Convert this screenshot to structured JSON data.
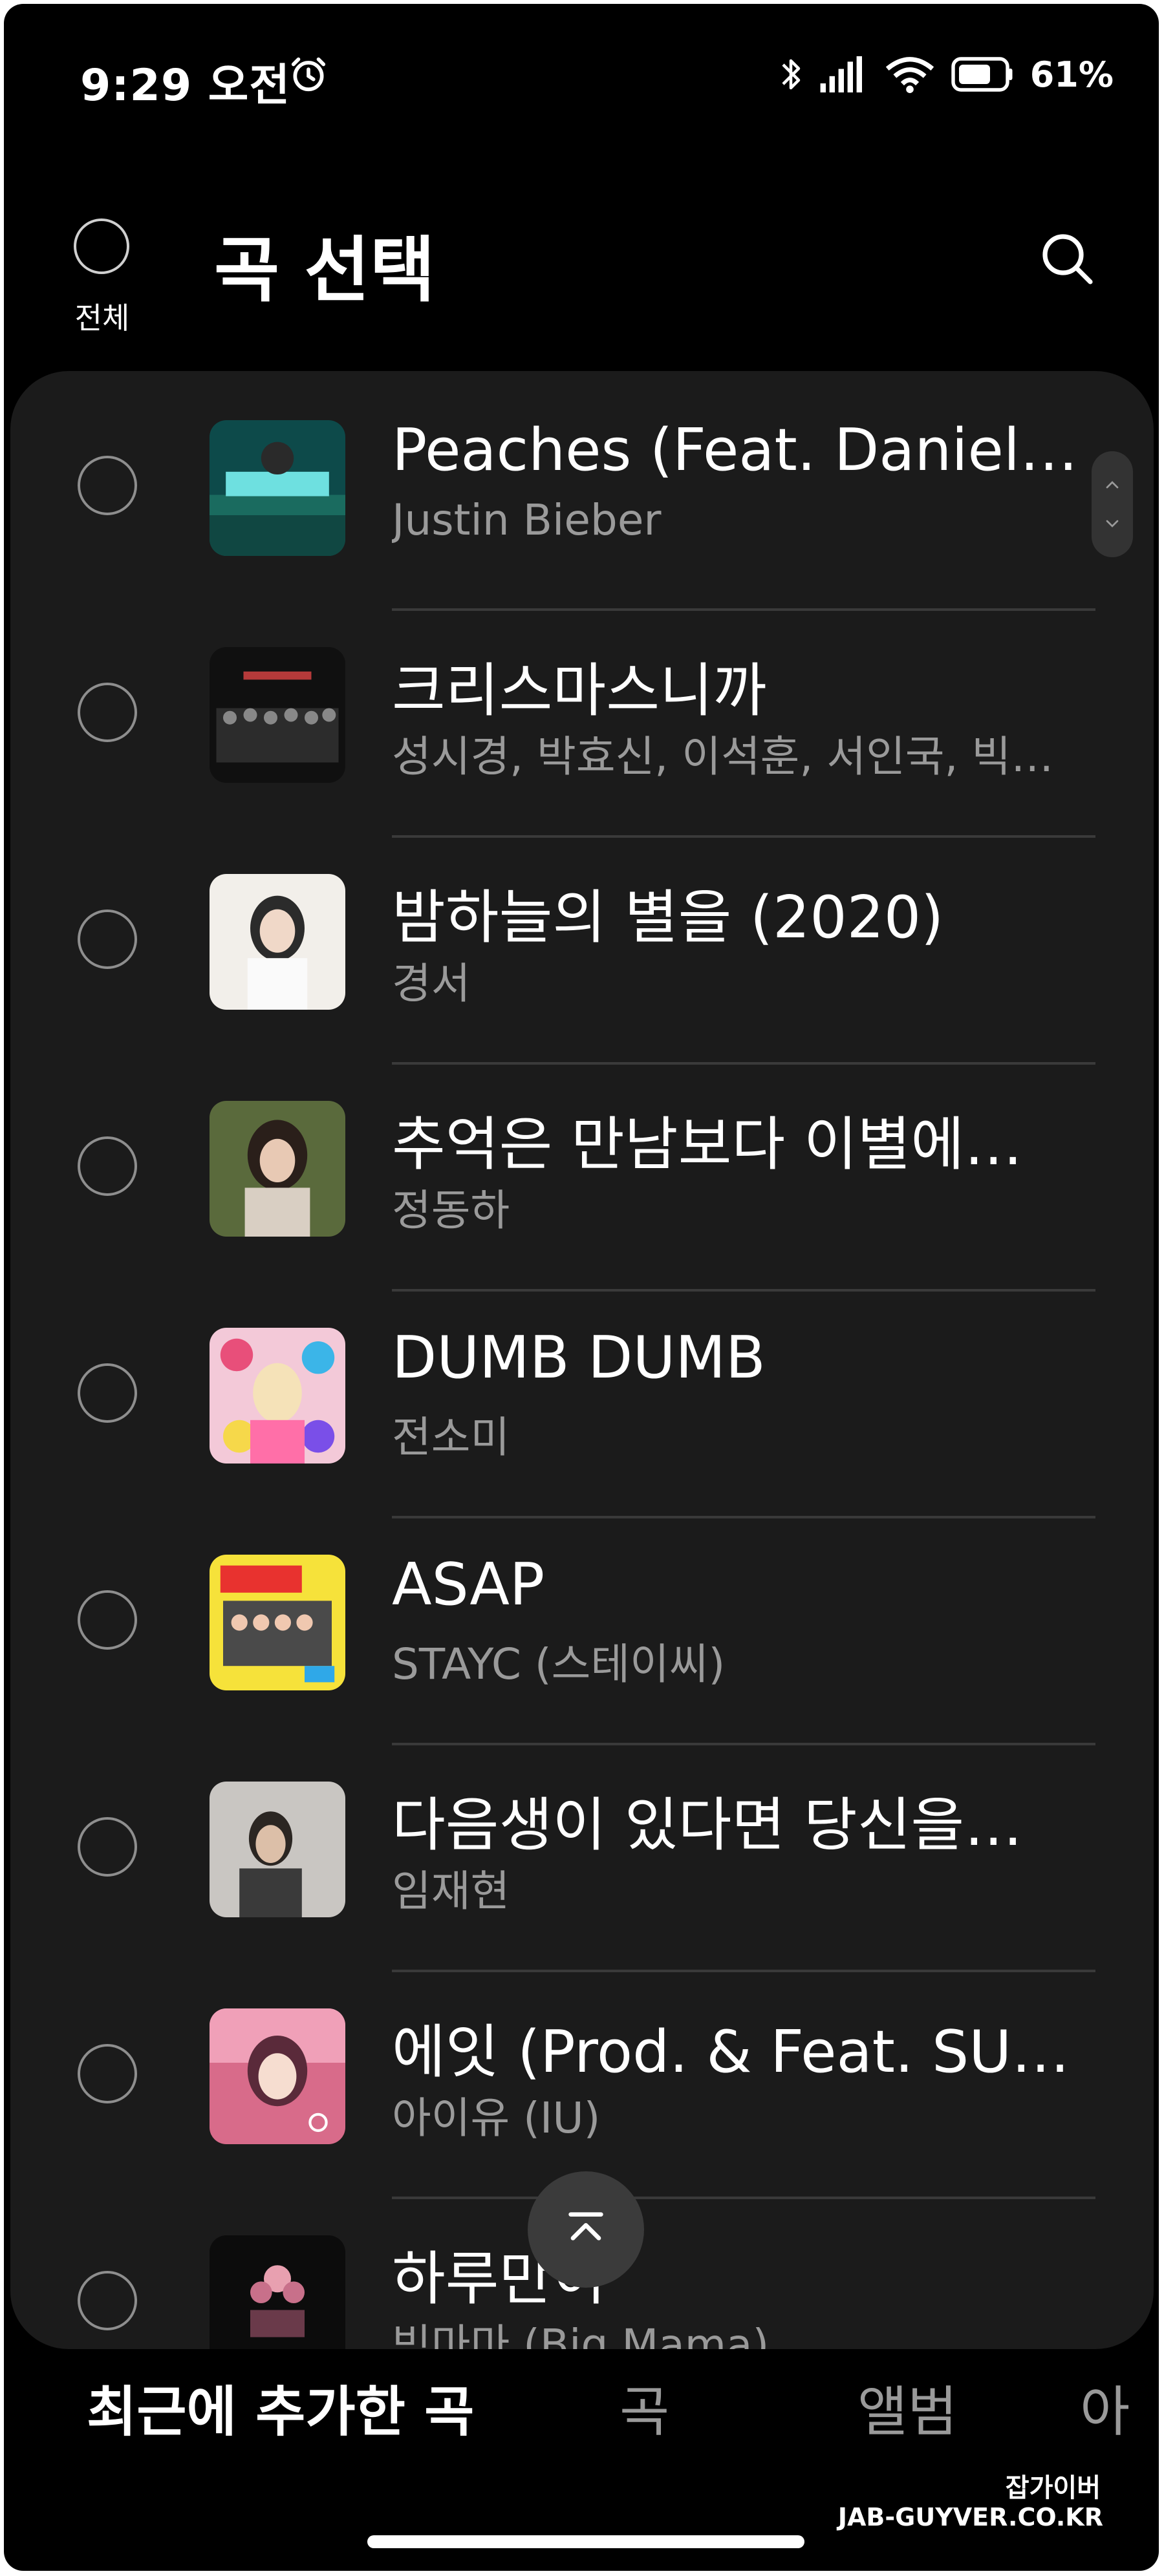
{
  "status_bar": {
    "time": "9:29 오전",
    "battery": "61%"
  },
  "header": {
    "select_all_label": "전체",
    "title": "곡 선택"
  },
  "songs": [
    {
      "title": "Peaches (Feat. Daniel…",
      "artist": "Justin Bieber"
    },
    {
      "title": "크리스마스니까",
      "artist": "성시경, 박효신, 이석훈, 서인국, 빅…"
    },
    {
      "title": "밤하늘의 별을 (2020)",
      "artist": "경서"
    },
    {
      "title": "추억은 만남보다 이별에…",
      "artist": "정동하"
    },
    {
      "title": "DUMB DUMB",
      "artist": "전소미"
    },
    {
      "title": "ASAP",
      "artist": "STAYC (스테이씨)"
    },
    {
      "title": "다음생이 있다면 당신을…",
      "artist": "임재현"
    },
    {
      "title": "에잇 (Prod. & Feat. SU…",
      "artist": "아이유 (IU)"
    },
    {
      "title": "하루만이",
      "artist": "빅마마 (Big Mama)"
    }
  ],
  "tabs": [
    {
      "label": "최근에 추가한 곡",
      "active": true
    },
    {
      "label": "곡",
      "active": false
    },
    {
      "label": "앨범",
      "active": false
    },
    {
      "label": "아",
      "active": false
    }
  ],
  "watermark": {
    "korean": "잡가이버",
    "domain": "JAB-GUYVER.CO.KR"
  },
  "colors": {
    "background": "#000000",
    "panel": "#1b1b1b",
    "primary_text": "#ffffff",
    "secondary_text": "#9a9a9a"
  }
}
